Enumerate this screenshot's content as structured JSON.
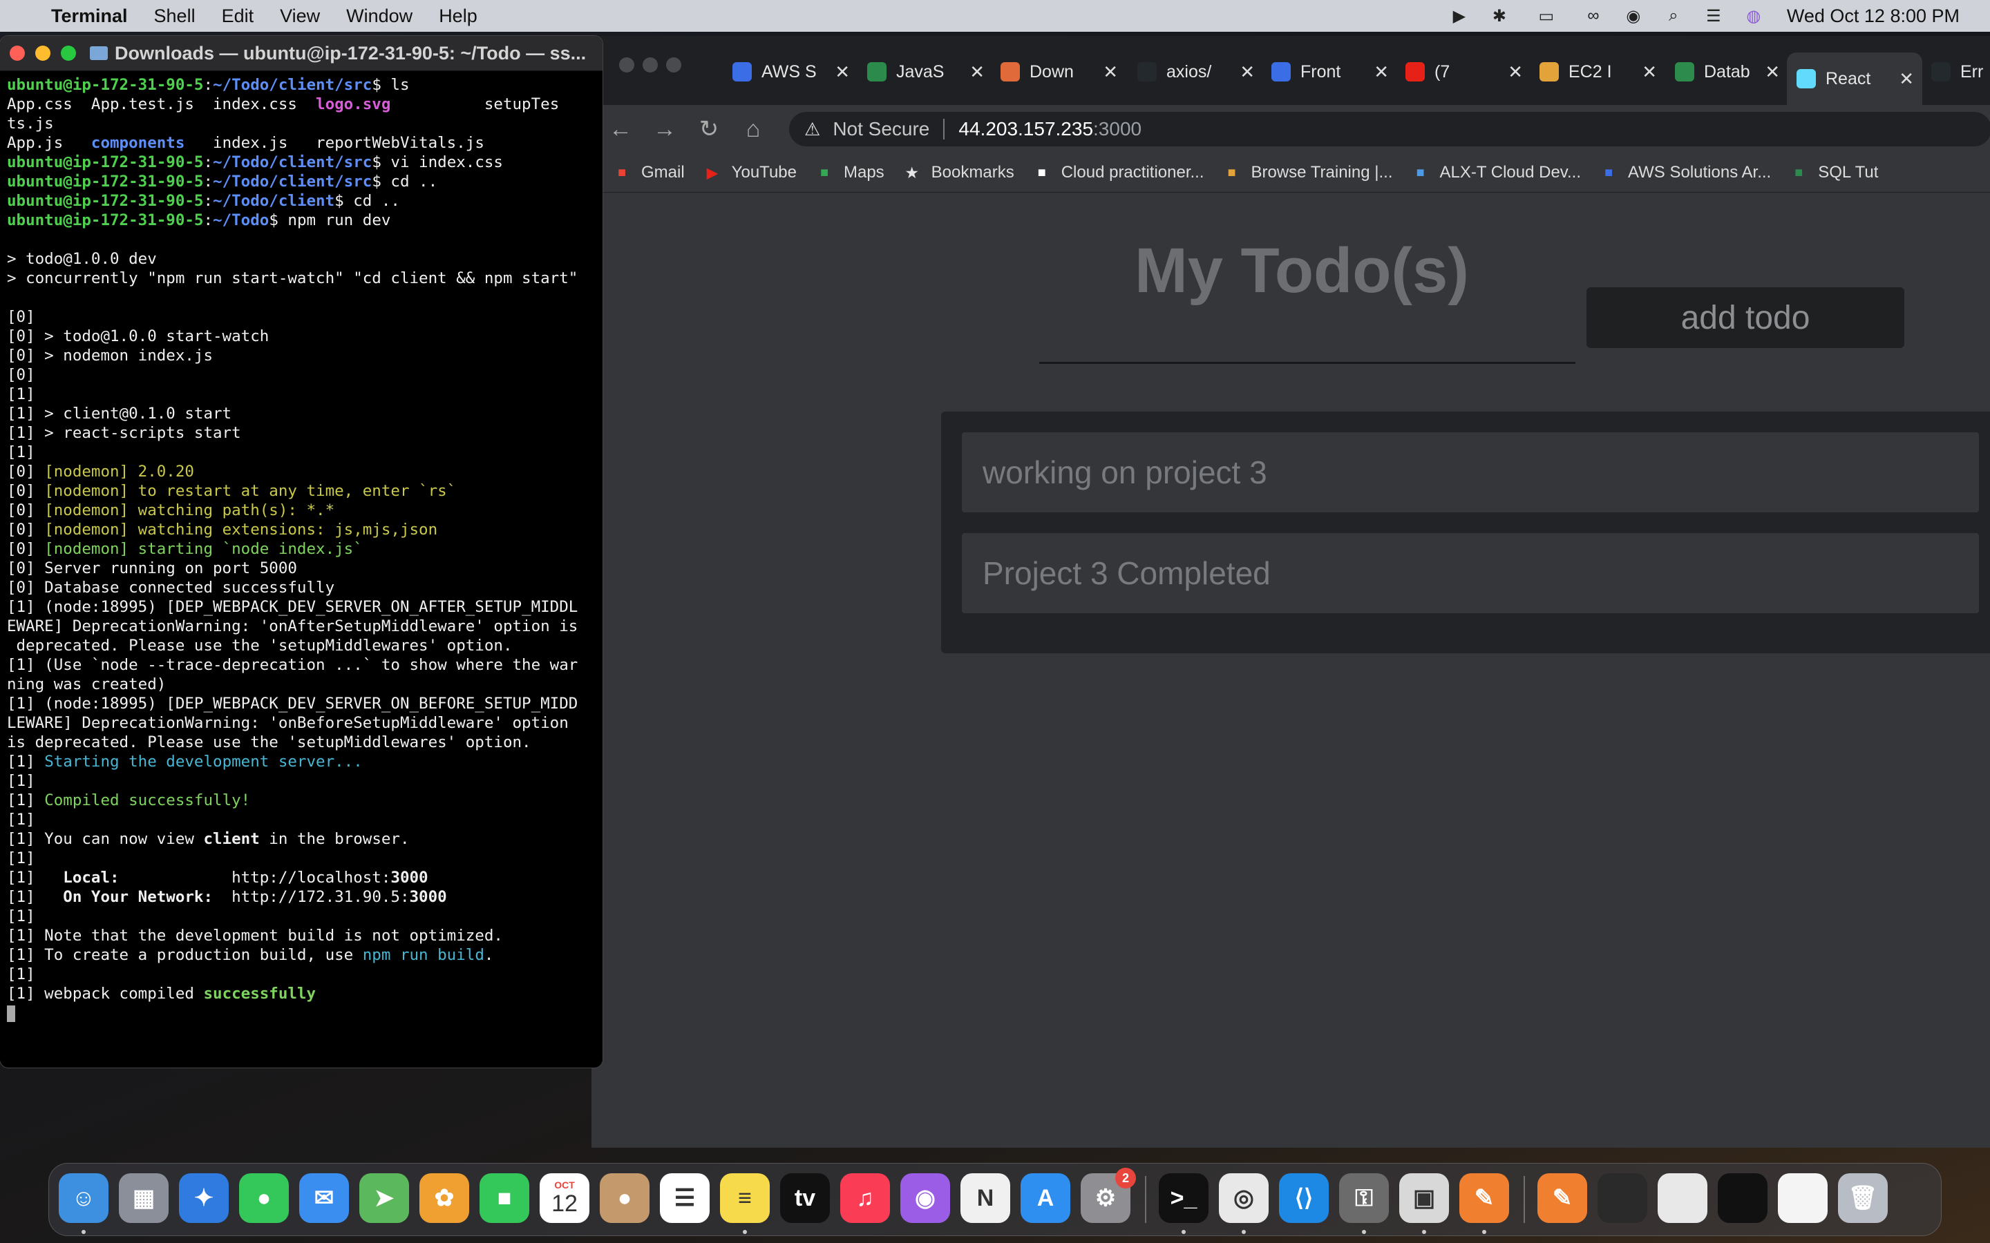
{
  "menubar": {
    "app": "Terminal",
    "items": [
      "Shell",
      "Edit",
      "View",
      "Window",
      "Help"
    ],
    "clock": "Wed Oct 12  8:00 PM",
    "status_icons": [
      "play-icon",
      "bluetooth-icon",
      "battery-icon",
      "link-icon",
      "user-icon",
      "search-icon",
      "control-center-icon",
      "siri-icon"
    ]
  },
  "terminal": {
    "title": "Downloads — ubuntu@ip-172-31-90-5: ~/Todo — ss...",
    "prompt_user": "ubuntu@ip-172-31-90-5",
    "lines": [
      {
        "parts": [
          {
            "c": "c-g",
            "t": "ubuntu@ip-172-31-90-5"
          },
          {
            "t": ":"
          },
          {
            "c": "c-b",
            "t": "~/Todo/client/src"
          },
          {
            "t": "$ ls"
          }
        ]
      },
      {
        "parts": [
          {
            "t": "App.css  App.test.js  index.css  "
          },
          {
            "c": "c-m",
            "t": "logo.svg"
          },
          {
            "t": "          setupTes"
          }
        ]
      },
      {
        "parts": [
          {
            "t": "ts.js"
          }
        ]
      },
      {
        "parts": [
          {
            "t": "App.js   "
          },
          {
            "c": "c-bl",
            "t": "components"
          },
          {
            "t": "   index.js   reportWebVitals.js"
          }
        ]
      },
      {
        "parts": [
          {
            "c": "c-g",
            "t": "ubuntu@ip-172-31-90-5"
          },
          {
            "t": ":"
          },
          {
            "c": "c-b",
            "t": "~/Todo/client/src"
          },
          {
            "t": "$ vi index.css"
          }
        ]
      },
      {
        "parts": [
          {
            "c": "c-g",
            "t": "ubuntu@ip-172-31-90-5"
          },
          {
            "t": ":"
          },
          {
            "c": "c-b",
            "t": "~/Todo/client/src"
          },
          {
            "t": "$ cd .."
          }
        ]
      },
      {
        "parts": [
          {
            "c": "c-g",
            "t": "ubuntu@ip-172-31-90-5"
          },
          {
            "t": ":"
          },
          {
            "c": "c-b",
            "t": "~/Todo/client"
          },
          {
            "t": "$ cd .."
          }
        ]
      },
      {
        "parts": [
          {
            "c": "c-g",
            "t": "ubuntu@ip-172-31-90-5"
          },
          {
            "t": ":"
          },
          {
            "c": "c-b",
            "t": "~/Todo"
          },
          {
            "t": "$ npm run dev"
          }
        ]
      },
      {
        "parts": [
          {
            "t": ""
          }
        ]
      },
      {
        "parts": [
          {
            "t": "> todo@1.0.0 dev"
          }
        ]
      },
      {
        "parts": [
          {
            "t": "> concurrently \"npm run start-watch\" \"cd client && npm start\""
          }
        ]
      },
      {
        "parts": [
          {
            "t": ""
          }
        ]
      },
      {
        "parts": [
          {
            "t": "[0]"
          }
        ]
      },
      {
        "parts": [
          {
            "t": "[0] > todo@1.0.0 start-watch"
          }
        ]
      },
      {
        "parts": [
          {
            "t": "[0] > nodemon index.js"
          }
        ]
      },
      {
        "parts": [
          {
            "t": "[0]"
          }
        ]
      },
      {
        "parts": [
          {
            "t": "[1]"
          }
        ]
      },
      {
        "parts": [
          {
            "t": "[1] > client@0.1.0 start"
          }
        ]
      },
      {
        "parts": [
          {
            "t": "[1] > react-scripts start"
          }
        ]
      },
      {
        "parts": [
          {
            "t": "[1]"
          }
        ]
      },
      {
        "parts": [
          {
            "t": "[0] "
          },
          {
            "c": "c-y",
            "t": "[nodemon] 2.0.20"
          }
        ]
      },
      {
        "parts": [
          {
            "t": "[0] "
          },
          {
            "c": "c-y",
            "t": "[nodemon] to restart at any time, enter `rs`"
          }
        ]
      },
      {
        "parts": [
          {
            "t": "[0] "
          },
          {
            "c": "c-y",
            "t": "[nodemon] watching path(s): *.*"
          }
        ]
      },
      {
        "parts": [
          {
            "t": "[0] "
          },
          {
            "c": "c-y",
            "t": "[nodemon] watching extensions: js,mjs,json"
          }
        ]
      },
      {
        "parts": [
          {
            "t": "[0] "
          },
          {
            "c": "c-gr",
            "t": "[nodemon] starting `node index.js`"
          }
        ]
      },
      {
        "parts": [
          {
            "t": "[0] Server running on port 5000"
          }
        ]
      },
      {
        "parts": [
          {
            "t": "[0] Database connected successfully"
          }
        ]
      },
      {
        "parts": [
          {
            "t": "[1] (node:18995) [DEP_WEBPACK_DEV_SERVER_ON_AFTER_SETUP_MIDDL"
          }
        ]
      },
      {
        "parts": [
          {
            "t": "EWARE] DeprecationWarning: 'onAfterSetupMiddleware' option is"
          }
        ]
      },
      {
        "parts": [
          {
            "t": " deprecated. Please use the 'setupMiddlewares' option."
          }
        ]
      },
      {
        "parts": [
          {
            "t": "[1] (Use `node --trace-deprecation ...` to show where the war"
          }
        ]
      },
      {
        "parts": [
          {
            "t": "ning was created)"
          }
        ]
      },
      {
        "parts": [
          {
            "t": "[1] (node:18995) [DEP_WEBPACK_DEV_SERVER_ON_BEFORE_SETUP_MIDD"
          }
        ]
      },
      {
        "parts": [
          {
            "t": "LEWARE] DeprecationWarning: 'onBeforeSetupMiddleware' option"
          }
        ]
      },
      {
        "parts": [
          {
            "t": "is deprecated. Please use the 'setupMiddlewares' option."
          }
        ]
      },
      {
        "parts": [
          {
            "t": "[1] "
          },
          {
            "c": "c-c",
            "t": "Starting the development server..."
          }
        ]
      },
      {
        "parts": [
          {
            "t": "[1]"
          }
        ]
      },
      {
        "parts": [
          {
            "t": "[1] "
          },
          {
            "c": "c-gr",
            "t": "Compiled successfully!"
          }
        ]
      },
      {
        "parts": [
          {
            "t": "[1]"
          }
        ]
      },
      {
        "parts": [
          {
            "t": "[1] You can now view "
          },
          {
            "c": "bold",
            "t": "client"
          },
          {
            "t": " in the browser."
          }
        ]
      },
      {
        "parts": [
          {
            "t": "[1]"
          }
        ]
      },
      {
        "parts": [
          {
            "t": "[1]   "
          },
          {
            "c": "bold",
            "t": "Local:"
          },
          {
            "t": "            http://localhost:"
          },
          {
            "c": "bold",
            "t": "3000"
          }
        ]
      },
      {
        "parts": [
          {
            "t": "[1]   "
          },
          {
            "c": "bold",
            "t": "On Your Network:"
          },
          {
            "t": "  http://172.31.90.5:"
          },
          {
            "c": "bold",
            "t": "3000"
          }
        ]
      },
      {
        "parts": [
          {
            "t": "[1]"
          }
        ]
      },
      {
        "parts": [
          {
            "t": "[1] Note that the development build is not optimized."
          }
        ]
      },
      {
        "parts": [
          {
            "t": "[1] To create a production build, use "
          },
          {
            "c": "c-c",
            "t": "npm run build"
          },
          {
            "t": "."
          }
        ]
      },
      {
        "parts": [
          {
            "t": "[1]"
          }
        ]
      },
      {
        "parts": [
          {
            "t": "[1] webpack compiled "
          },
          {
            "c": "c-gb",
            "t": "successfully"
          }
        ]
      }
    ]
  },
  "browser": {
    "tabs": [
      {
        "label": "AWS S",
        "icon": "aws-icon",
        "color": "#3b6de6"
      },
      {
        "label": "JavaS",
        "icon": "w3schools-icon",
        "color": "#2c8a4d"
      },
      {
        "label": "Down",
        "icon": "download-app-icon",
        "color": "#e06a3a"
      },
      {
        "label": "axios/",
        "icon": "github-icon",
        "color": "#24292e"
      },
      {
        "label": "Front",
        "icon": "aws-icon",
        "color": "#3b6de6"
      },
      {
        "label": "(7",
        "icon": "youtube-icon",
        "color": "#e62117"
      },
      {
        "label": "EC2 I",
        "icon": "aws-box-icon",
        "color": "#e3a33b"
      },
      {
        "label": "Datab",
        "icon": "mongodb-icon",
        "color": "#2d8b4e"
      },
      {
        "label": "React",
        "icon": "react-icon",
        "color": "#61dafb"
      },
      {
        "label": "Err",
        "icon": "github-icon",
        "color": "#24292e"
      }
    ],
    "not_secure": "Not Secure",
    "url_host": "44.203.157.235",
    "url_port": ":3000",
    "bookmarks": [
      {
        "label": "Gmail",
        "icon": "gmail-icon",
        "color": "#ea4335"
      },
      {
        "label": "YouTube",
        "icon": "youtube-icon",
        "color": "#e62117"
      },
      {
        "label": "Maps",
        "icon": "maps-icon",
        "color": "#34a853"
      },
      {
        "label": "Bookmarks",
        "icon": "star-icon",
        "color": "#e6e6e6"
      },
      {
        "label": "Cloud practitioner...",
        "icon": "aws-icon",
        "color": "#ffffff"
      },
      {
        "label": "Browse Training |...",
        "icon": "cloud-icon",
        "color": "#e3a33b"
      },
      {
        "label": "ALX-T Cloud Dev...",
        "icon": "udacity-icon",
        "color": "#4c9be8"
      },
      {
        "label": "AWS Solutions Ar...",
        "icon": "aws-icon",
        "color": "#3b6de6"
      },
      {
        "label": "SQL Tut",
        "icon": "w3schools-icon",
        "color": "#2c8a4d"
      }
    ]
  },
  "app": {
    "title": "My Todo(s)",
    "input_value": "",
    "add_button": "add todo",
    "todos": [
      "working on project 3",
      "Project 3 Completed"
    ]
  },
  "dock": {
    "apps": [
      {
        "name": "finder-icon",
        "color": "#3d8fe0",
        "glyph": "☺"
      },
      {
        "name": "launchpad-icon",
        "color": "#8a8f99",
        "glyph": "▦"
      },
      {
        "name": "safari-icon",
        "color": "#2f7be0",
        "glyph": "✦"
      },
      {
        "name": "messages-icon",
        "color": "#34c759",
        "glyph": "●"
      },
      {
        "name": "mail-icon",
        "color": "#3a8ef0",
        "glyph": "✉"
      },
      {
        "name": "maps-icon",
        "color": "#5cb85c",
        "glyph": "➤"
      },
      {
        "name": "photos-icon",
        "color": "#f0a030",
        "glyph": "✿"
      },
      {
        "name": "facetime-icon",
        "color": "#34c759",
        "glyph": "■"
      },
      {
        "name": "calendar-icon",
        "color": "#ffffff",
        "glyph": "12"
      },
      {
        "name": "contacts-icon",
        "color": "#c49a6c",
        "glyph": "●"
      },
      {
        "name": "reminders-icon",
        "color": "#ffffff",
        "glyph": "☰"
      },
      {
        "name": "notes-icon",
        "color": "#f7d94c",
        "glyph": "≡"
      },
      {
        "name": "appletv-icon",
        "color": "#111111",
        "glyph": "tv"
      },
      {
        "name": "music-icon",
        "color": "#fa3c55",
        "glyph": "♫"
      },
      {
        "name": "podcasts-icon",
        "color": "#9b5de5",
        "glyph": "◉"
      },
      {
        "name": "news-icon",
        "color": "#f0f0f0",
        "glyph": "N"
      },
      {
        "name": "appstore-icon",
        "color": "#2f8ff0",
        "glyph": "A"
      },
      {
        "name": "system-settings-icon",
        "color": "#8e8e93",
        "glyph": "⚙"
      },
      {
        "name": "terminal-icon",
        "color": "#111111",
        "glyph": ">_"
      },
      {
        "name": "chrome-icon",
        "color": "#e8e8e8",
        "glyph": "◎"
      },
      {
        "name": "vscode-icon",
        "color": "#1e88e5",
        "glyph": "⟨⟩"
      },
      {
        "name": "keychain-icon",
        "color": "#6b6b6b",
        "glyph": "⚿"
      },
      {
        "name": "preview-icon",
        "color": "#d8d8d8",
        "glyph": "▣"
      },
      {
        "name": "pages-icon",
        "color": "#f08030",
        "glyph": "✎"
      },
      {
        "name": "pages-doc-icon",
        "color": "#f08030",
        "glyph": "✎"
      },
      {
        "name": "window-thumb-1-icon",
        "color": "#2a2a2a",
        "glyph": ""
      },
      {
        "name": "window-thumb-2-icon",
        "color": "#e8e8e8",
        "glyph": ""
      },
      {
        "name": "window-thumb-3-icon",
        "color": "#111111",
        "glyph": ""
      },
      {
        "name": "window-thumb-4-icon",
        "color": "#f4f4f4",
        "glyph": ""
      },
      {
        "name": "trash-icon",
        "color": "#b8bcc4",
        "glyph": "🗑"
      }
    ],
    "settings_badge": "2",
    "calendar_month": "OCT",
    "calendar_day": "12"
  }
}
